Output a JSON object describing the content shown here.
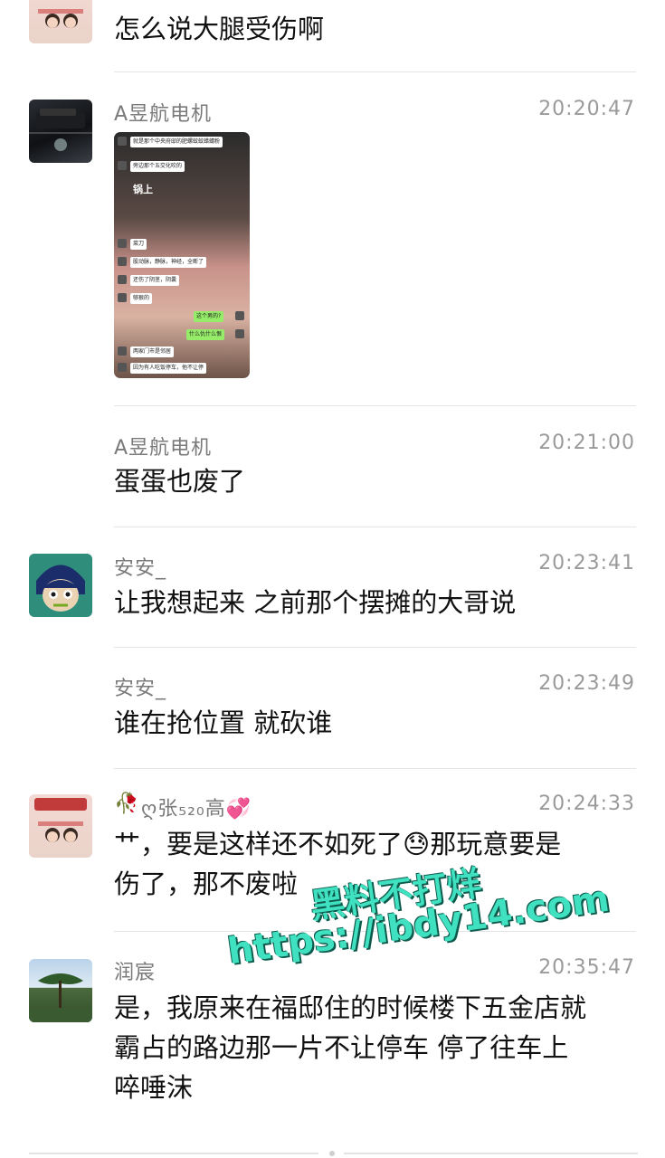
{
  "messages": [
    {
      "text": "怎么说大腿受伤啊"
    },
    {
      "name": "A昱航电机",
      "time": "20:20:47",
      "screenshot": {
        "lines": [
          "就是那个中央府邸的肥螺蚊蚊蜡蜻粉",
          "旁边那个五交化吹的",
          "锅上",
          "菜刀",
          "股动脉，静脉，神经，全断了",
          "还伤了阴茎，阴囊",
          "够狠的",
          "这个男的?",
          "什么仇什么恨",
          "两家门市是邻居",
          "因为有人吃饭停车，他不让停"
        ]
      }
    },
    {
      "name": "A昱航电机",
      "time": "20:21:00",
      "text": "蛋蛋也废了"
    },
    {
      "name": "安安_",
      "time": "20:23:41",
      "text": "让我想起来 之前那个摆摊的大哥说"
    },
    {
      "name": "安安_",
      "time": "20:23:49",
      "text": "谁在抢位置 就砍谁"
    },
    {
      "name": "ღ张₅₂₀高💞",
      "time": "20:24:33",
      "text_a": "艹，要是这样还不如死了",
      "emoji": "😓",
      "text_b": "那玩意要是",
      "text_c": "伤了，那不废啦"
    },
    {
      "name": "润宸",
      "time": "20:35:47",
      "lines": [
        "是，我原来在福邸住的时候楼下五金店就",
        "霸占的路边那一片不让停车 停了往车上",
        "啐唾沫"
      ]
    }
  ],
  "watermark": {
    "line1": "黑料不打烊",
    "line2": "https://ibdy14.com"
  }
}
